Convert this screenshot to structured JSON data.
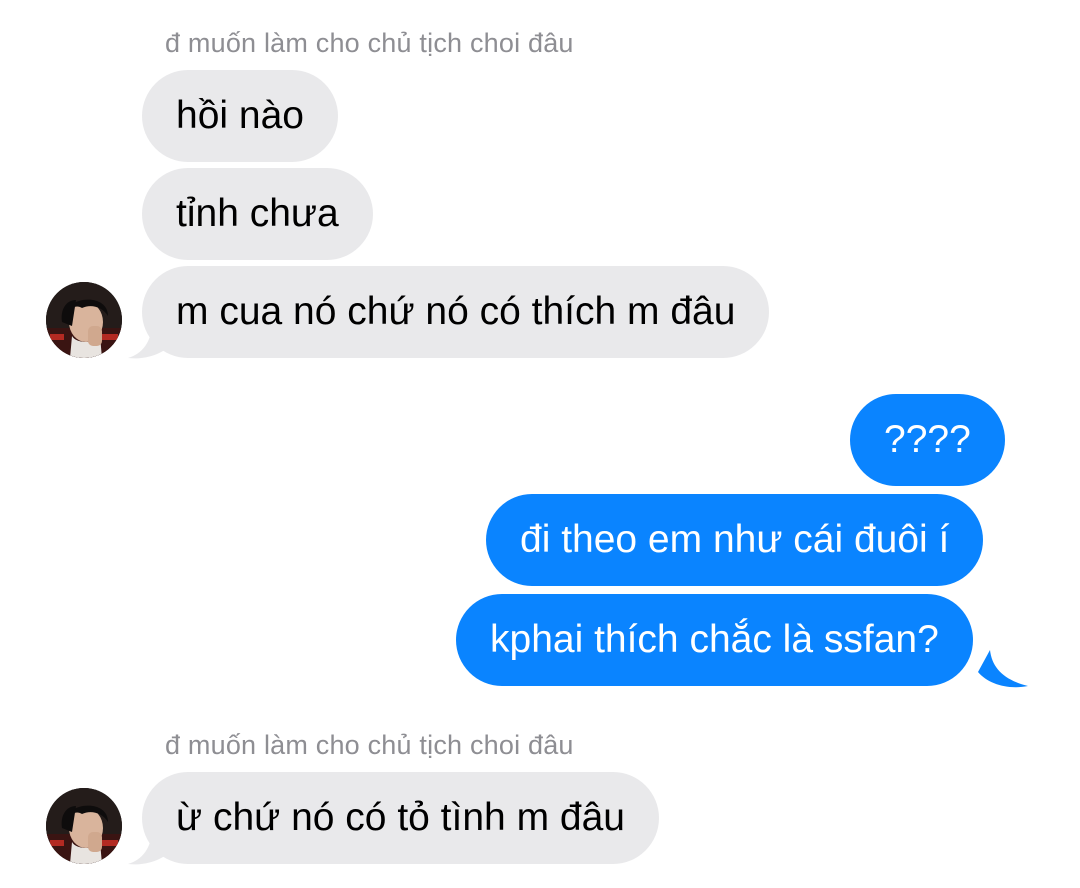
{
  "colors": {
    "incoming_bubble": "#e9e9eb",
    "outgoing_bubble": "#0a84ff",
    "sender_name": "#8e8e93"
  },
  "conversation": {
    "group1": {
      "sender": "đ muốn làm cho chủ tịch choi đâu",
      "messages": [
        "hồi nào",
        "tỉnh chưa",
        "m cua nó chứ nó có thích m đâu"
      ],
      "avatar_icon": "contact-avatar-photo"
    },
    "outgoing": {
      "messages": [
        "????",
        "đi theo em như cái đuôi í",
        "kphai thích chắc là ssfan?"
      ]
    },
    "group2": {
      "sender": "đ muốn làm cho chủ tịch choi đâu",
      "messages": [
        "ừ chứ nó có tỏ tình m đâu"
      ],
      "avatar_icon": "contact-avatar-photo"
    }
  }
}
